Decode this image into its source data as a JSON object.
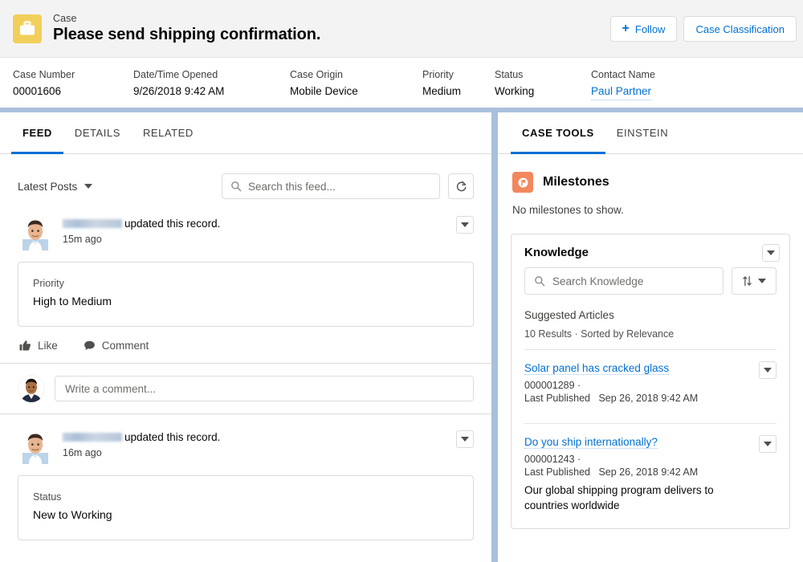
{
  "header": {
    "icon": "briefcase-icon",
    "icon_color": "#f2cf5b",
    "eyebrow": "Case",
    "title": "Please send shipping confirmation.",
    "actions": {
      "follow_label": "Follow",
      "follow_icon": "plus-icon",
      "classification_label": "Case Classification"
    },
    "fields": [
      {
        "label": "Case Number",
        "value": "00001606",
        "is_link": false
      },
      {
        "label": "Date/Time Opened",
        "value": "9/26/2018 9:42 AM",
        "is_link": false
      },
      {
        "label": "Case Origin",
        "value": "Mobile Device",
        "is_link": false
      },
      {
        "label": "Priority",
        "value": "Medium",
        "is_link": false
      },
      {
        "label": "Status",
        "value": "Working",
        "is_link": false
      },
      {
        "label": "Contact Name",
        "value": "Paul Partner",
        "is_link": true
      }
    ]
  },
  "left_panel": {
    "tabs": [
      {
        "label": "FEED",
        "active": true
      },
      {
        "label": "DETAILS",
        "active": false
      },
      {
        "label": "RELATED",
        "active": false
      }
    ],
    "toolbar": {
      "sort_label": "Latest Posts",
      "sort_icon": "chevron-down-icon",
      "search_placeholder": "Search this feed...",
      "search_value": "",
      "search_icon": "search-icon",
      "refresh_icon": "refresh-icon"
    },
    "posts": [
      {
        "author": "",
        "author_redacted": true,
        "action_text": "updated this record.",
        "time": "15m ago",
        "menu_icon": "chevron-down-icon",
        "change": {
          "label": "Priority",
          "value": "High to Medium"
        },
        "actions": [
          {
            "label": "Like",
            "icon": "thumbs-up-icon"
          },
          {
            "label": "Comment",
            "icon": "comment-bubble-icon"
          }
        ],
        "comment_placeholder": "Write a comment..."
      },
      {
        "author": "",
        "author_redacted": true,
        "action_text": "updated this record.",
        "time": "16m ago",
        "menu_icon": "chevron-down-icon",
        "change": {
          "label": "Status",
          "value": "New to Working"
        }
      }
    ]
  },
  "right_panel": {
    "tabs": [
      {
        "label": "CASE TOOLS",
        "active": true
      },
      {
        "label": "EINSTEIN",
        "active": false
      }
    ],
    "milestones": {
      "icon": "milestone-flag-icon",
      "icon_color": "#f2875e",
      "title": "Milestones",
      "empty_text": "No milestones to show."
    },
    "knowledge": {
      "title": "Knowledge",
      "menu_icon": "chevron-down-icon",
      "search_placeholder": "Search Knowledge",
      "search_value": "",
      "search_icon": "search-icon",
      "sort_icon": "sort-arrows-icon",
      "sort_caret_icon": "chevron-down-icon",
      "subheading": "Suggested Articles",
      "result_summary": "10 Results · Sorted by Relevance",
      "articles": [
        {
          "title": "Solar panel has cracked glass",
          "number": "000001289",
          "separator": "·",
          "published_label": "Last Published",
          "published_date": "Sep 26, 2018 9:42 AM",
          "snippet": "",
          "menu_icon": "chevron-down-icon"
        },
        {
          "title": "Do you ship internationally?",
          "number": "000001243",
          "separator": "·",
          "published_label": "Last Published",
          "published_date": "Sep 26, 2018 9:42 AM",
          "snippet": "Our global shipping program delivers to countries worldwide",
          "menu_icon": "chevron-down-icon"
        }
      ]
    }
  },
  "colors": {
    "accent_blue": "#0070d2",
    "page_background": "#aabfdc",
    "header_strip": "#f3f3f3",
    "case_icon": "#f2cf5b",
    "milestone_icon": "#f2875e",
    "border": "#dddbda"
  }
}
